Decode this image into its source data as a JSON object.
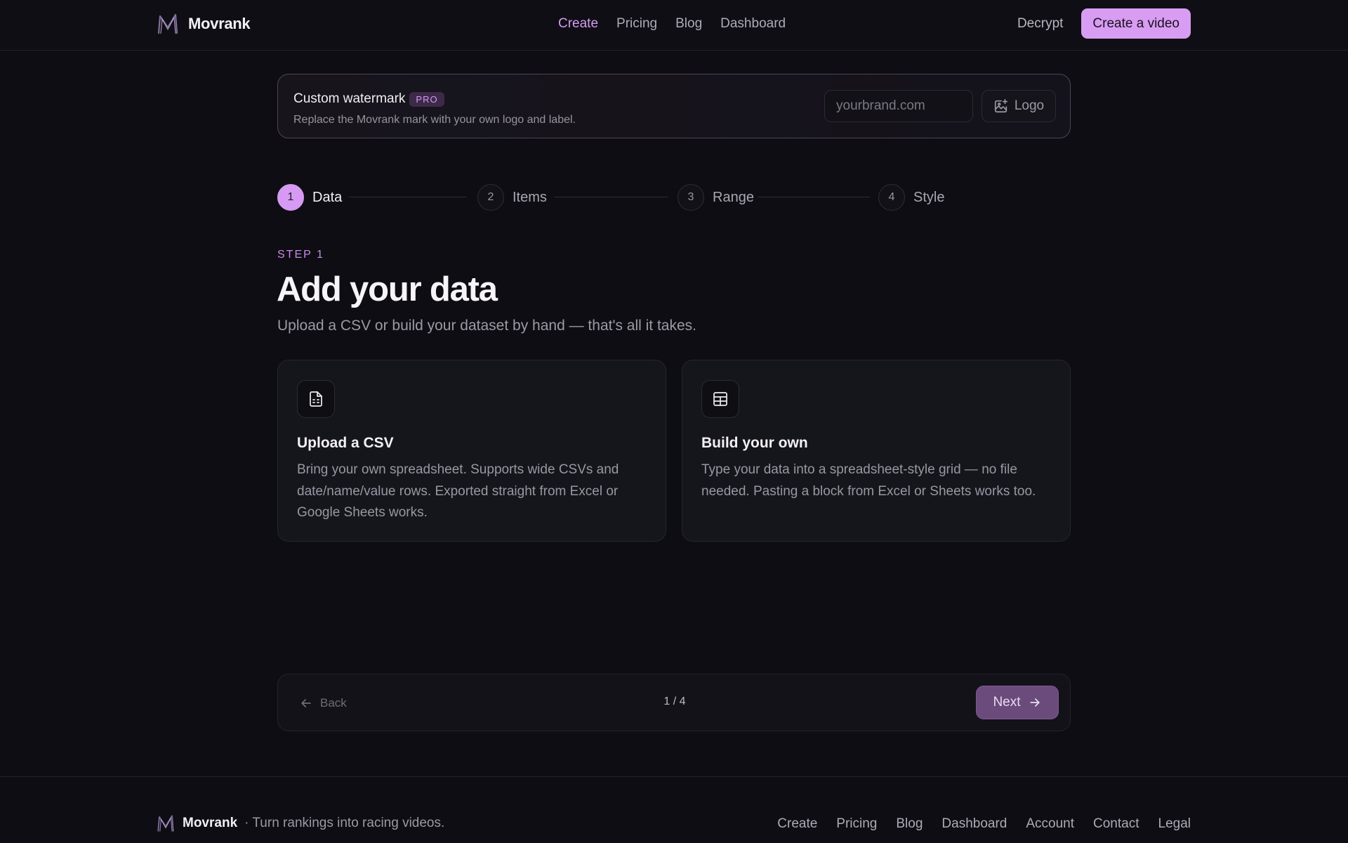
{
  "header": {
    "brand": "Movrank",
    "nav": [
      "Create",
      "Pricing",
      "Blog",
      "Dashboard"
    ],
    "active_nav": "Create",
    "decrypt_label": "Decrypt",
    "cta_label": "Create a video"
  },
  "watermark": {
    "title": "Custom watermark",
    "badge": "PRO",
    "description": "Replace the Movrank mark with your own logo and label.",
    "input_placeholder": "yourbrand.com",
    "input_value": "",
    "logo_button_label": "Logo"
  },
  "stepper": {
    "steps": [
      {
        "number": "1",
        "label": "Data",
        "active": true
      },
      {
        "number": "2",
        "label": "Items",
        "active": false
      },
      {
        "number": "3",
        "label": "Range",
        "active": false
      },
      {
        "number": "4",
        "label": "Style",
        "active": false
      }
    ]
  },
  "step_content": {
    "eyebrow": "STEP 1",
    "title": "Add your data",
    "subtitle": "Upload a CSV or build your dataset by hand — that's all it takes.",
    "options": [
      {
        "icon": "file-csv-icon",
        "title": "Upload a CSV",
        "description": "Bring your own spreadsheet. Supports wide CSVs and date/name/value rows. Exported straight from Excel or Google Sheets works."
      },
      {
        "icon": "table-grid-icon",
        "title": "Build your own",
        "description": "Type your data into a spreadsheet-style grid — no file needed. Pasting a block from Excel or Sheets works too."
      }
    ]
  },
  "wizard_nav": {
    "back_label": "Back",
    "page_indicator": "1 / 4",
    "next_label": "Next"
  },
  "footer": {
    "brand": "Movrank",
    "tagline": "· Turn rankings into racing videos.",
    "links": [
      "Create",
      "Pricing",
      "Blog",
      "Dashboard",
      "Account",
      "Contact",
      "Legal"
    ]
  },
  "colors": {
    "background": "#0d0d13",
    "accent": "#d79af2",
    "next_button": "#6b4a7c"
  }
}
